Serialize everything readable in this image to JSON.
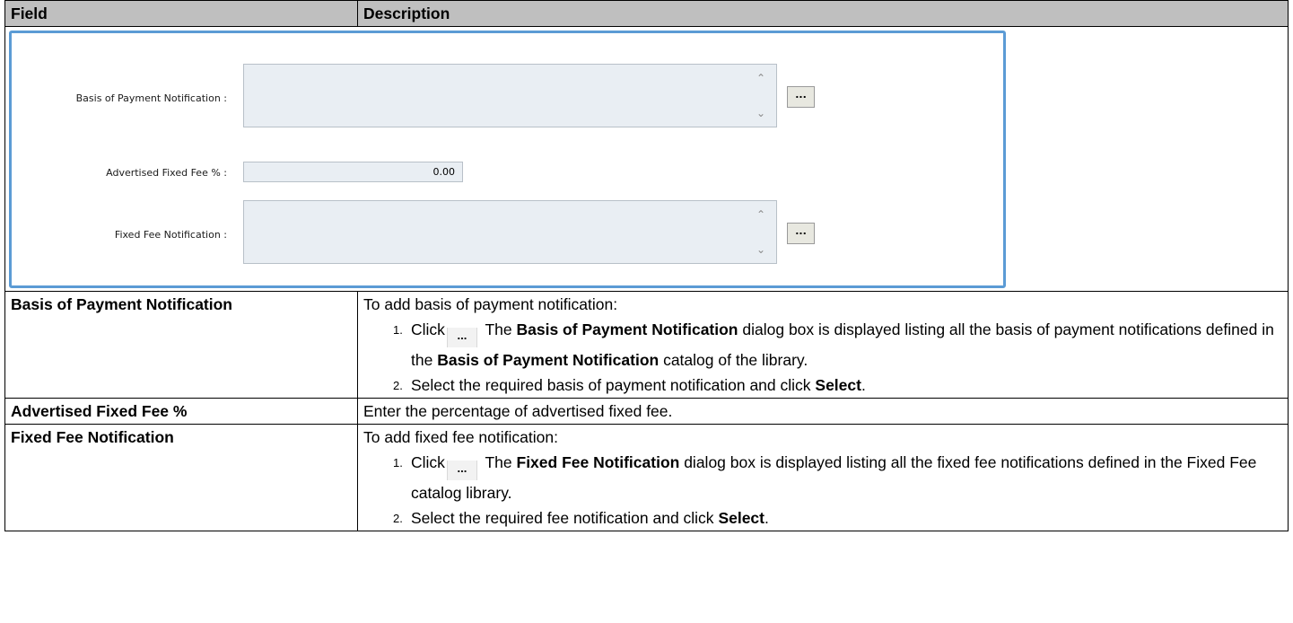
{
  "table": {
    "header_field": "Field",
    "header_description": "Description"
  },
  "form": {
    "basis_label": "Basis of Payment Notification :",
    "advertised_label": "Advertised Fixed Fee % :",
    "advertised_value": "0.00",
    "fixed_fee_label": "Fixed Fee Notification :",
    "browse_label": "..."
  },
  "rows": {
    "basis": {
      "field": "Basis of Payment Notification",
      "intro": "To add basis of payment notification:",
      "step1_num": "1.",
      "step1_click": "Click",
      "step1_btn": "...",
      "step1_pre": "The",
      "step1_bold1": "Basis of Payment Notification",
      "step1_mid": "dialog box is displayed listing all the basis of payment notifications defined in the",
      "step1_bold2": "Basis of  Payment Notification",
      "step1_post": "catalog of the library.",
      "step2_num": "2.",
      "step2_text": "Select the required basis of payment notification and click",
      "step2_bold": "Select",
      "step2_end": "."
    },
    "advertised": {
      "field": "Advertised Fixed Fee %",
      "desc": "Enter the percentage of advertised fixed fee."
    },
    "fixed": {
      "field": "Fixed Fee Notification",
      "intro": "To add fixed fee notification:",
      "step1_num": "1.",
      "step1_click": "Click",
      "step1_btn": "...",
      "step1_pre": "The",
      "step1_bold1": "Fixed Fee Notification",
      "step1_post": "dialog box is displayed listing all the fixed fee  notifications defined in the Fixed Fee catalog library.",
      "step2_num": "2.",
      "step2_text": "Select the required fee notification and click",
      "step2_bold": "Select",
      "step2_end": "."
    }
  }
}
